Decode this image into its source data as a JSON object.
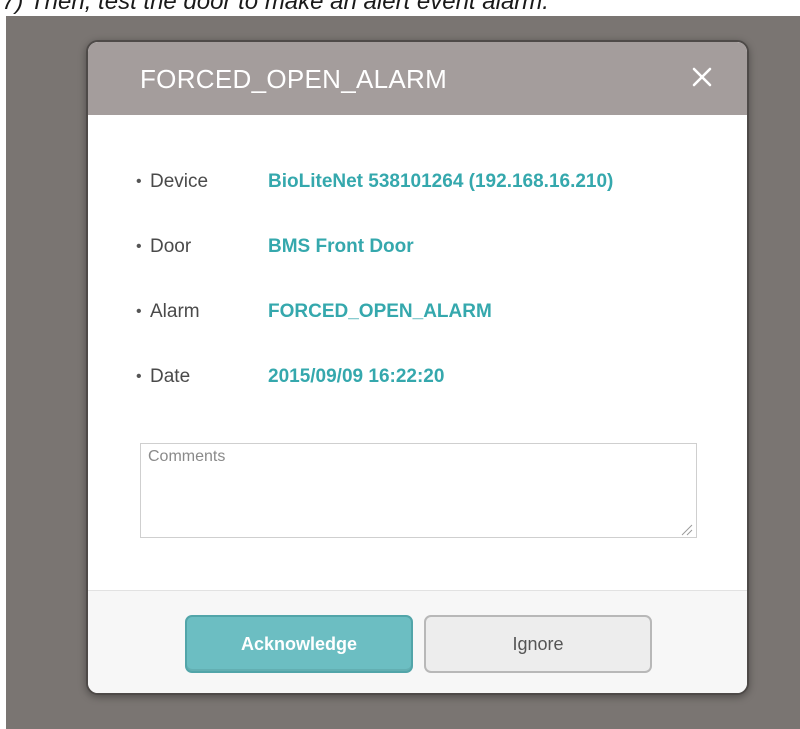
{
  "caption": "7) Then, test the door to make an alert event alarm.",
  "dialog": {
    "title": "FORCED_OPEN_ALARM",
    "close_icon": "close-icon",
    "fields": [
      {
        "label": "Device",
        "value": "BioLiteNet 538101264 (192.168.16.210)"
      },
      {
        "label": "Door",
        "value": "BMS Front Door"
      },
      {
        "label": "Alarm",
        "value": "FORCED_OPEN_ALARM"
      },
      {
        "label": "Date",
        "value": "2015/09/09 16:22:20"
      }
    ],
    "bullet": "•",
    "comments": {
      "placeholder": "Comments",
      "value": ""
    },
    "buttons": {
      "acknowledge": "Acknowledge",
      "ignore": "Ignore"
    }
  },
  "colors": {
    "header": "#a49d9c",
    "value_text": "#35a8ad",
    "primary_button": "#6cbec2",
    "backdrop": "#7a7572"
  }
}
